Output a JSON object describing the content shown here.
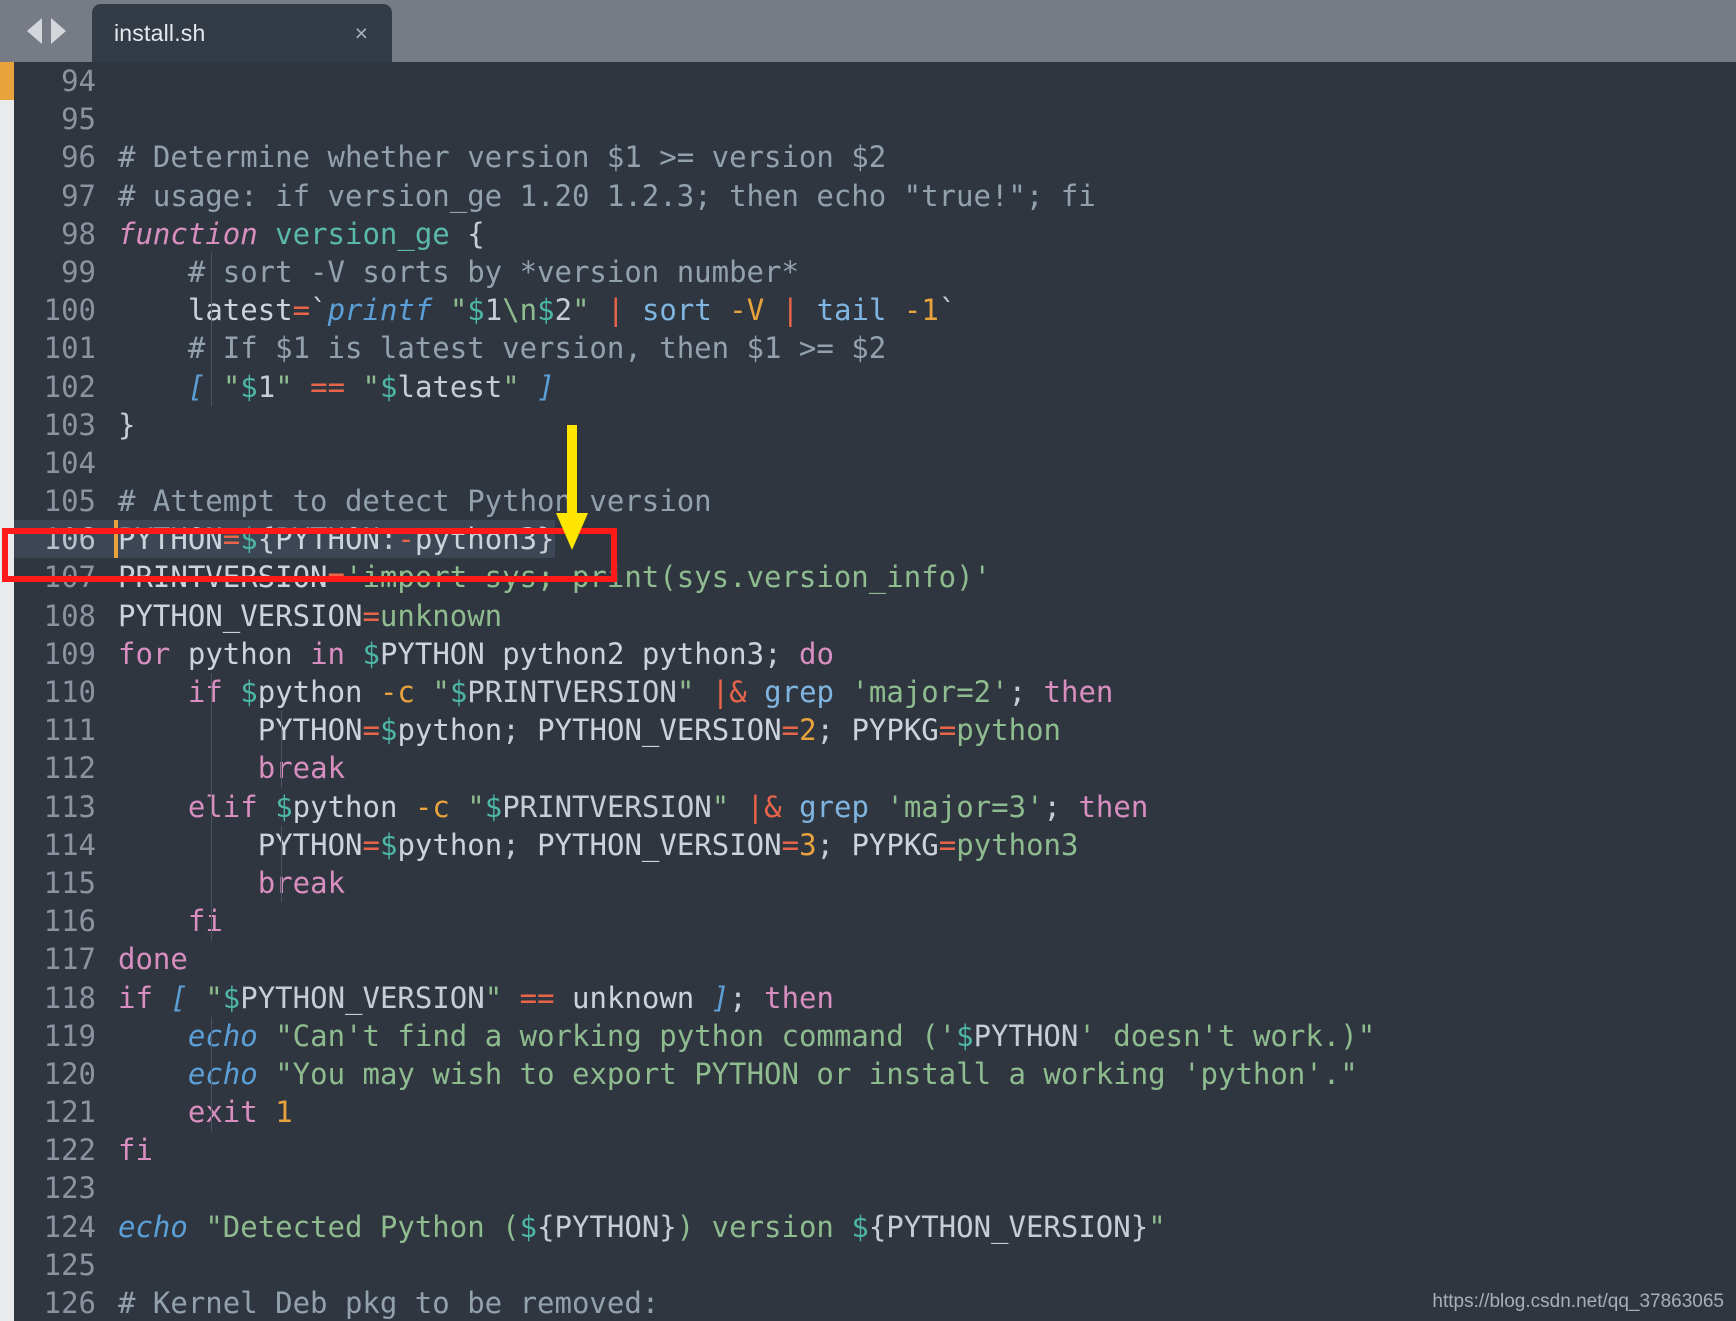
{
  "window": {
    "tab_title": "install.sh",
    "close_label": "×",
    "nav_back_icon": "arrow-left-icon",
    "nav_forward_icon": "arrow-right-icon"
  },
  "theme": {
    "tabbar_bg": "#767b85",
    "tab_bg": "#333b47",
    "editor_bg": "#2f3640",
    "gutter_text": "#8b939f",
    "current_line_bg": "#3c4654",
    "cursor_marker": "#e8a33d",
    "annotation_red": "#ff1a1a",
    "annotation_yellow": "#ffe600",
    "comment": "#93a1ad",
    "keyword": "#d88fc0",
    "string": "#8fbc8f",
    "operator": "#e8654a",
    "variable": "#4db6a4",
    "number": "#e8a33d",
    "builtin": "#5b9fd6"
  },
  "annotations": {
    "highlight_line": 106,
    "arrow_icon": "down-arrow-icon",
    "arrow_target_line": 106,
    "red_box_label": "highlight-box"
  },
  "watermark": "https://blog.csdn.net/qq_37863065",
  "editor": {
    "first_line": 94,
    "last_line": 126,
    "current_line": 106,
    "lines": [
      {
        "n": "94",
        "text": ""
      },
      {
        "n": "95",
        "text": ""
      },
      {
        "n": "96",
        "text": "# Determine whether version $1 >= version $2"
      },
      {
        "n": "97",
        "text": "# usage: if version_ge 1.20 1.2.3; then echo \"true!\"; fi"
      },
      {
        "n": "98",
        "text": "function version_ge {"
      },
      {
        "n": "99",
        "text": "    # sort -V sorts by *version number*"
      },
      {
        "n": "100",
        "text": "    latest=`printf \"$1\\n$2\" | sort -V | tail -1`"
      },
      {
        "n": "101",
        "text": "    # If $1 is latest version, then $1 >= $2"
      },
      {
        "n": "102",
        "text": "    [ \"$1\" == \"$latest\" ]"
      },
      {
        "n": "103",
        "text": "}"
      },
      {
        "n": "104",
        "text": ""
      },
      {
        "n": "105",
        "text": "# Attempt to detect Python version"
      },
      {
        "n": "106",
        "text": "PYTHON=${PYTHON:-python3}"
      },
      {
        "n": "107",
        "text": "PRINTVERSION='import sys; print(sys.version_info)'"
      },
      {
        "n": "108",
        "text": "PYTHON_VERSION=unknown"
      },
      {
        "n": "109",
        "text": "for python in $PYTHON python2 python3; do"
      },
      {
        "n": "110",
        "text": "    if $python -c \"$PRINTVERSION\" |& grep 'major=2'; then"
      },
      {
        "n": "111",
        "text": "        PYTHON=$python; PYTHON_VERSION=2; PYPKG=python"
      },
      {
        "n": "112",
        "text": "        break"
      },
      {
        "n": "113",
        "text": "    elif $python -c \"$PRINTVERSION\" |& grep 'major=3'; then"
      },
      {
        "n": "114",
        "text": "        PYTHON=$python; PYTHON_VERSION=3; PYPKG=python3"
      },
      {
        "n": "115",
        "text": "        break"
      },
      {
        "n": "116",
        "text": "    fi"
      },
      {
        "n": "117",
        "text": "done"
      },
      {
        "n": "118",
        "text": "if [ \"$PYTHON_VERSION\" == unknown ]; then"
      },
      {
        "n": "119",
        "text": "    echo \"Can't find a working python command ('$PYTHON' doesn't work.)\""
      },
      {
        "n": "120",
        "text": "    echo \"You may wish to export PYTHON or install a working 'python'.\""
      },
      {
        "n": "121",
        "text": "    exit 1"
      },
      {
        "n": "122",
        "text": "fi"
      },
      {
        "n": "123",
        "text": ""
      },
      {
        "n": "124",
        "text": "echo \"Detected Python (${PYTHON}) version ${PYTHON_VERSION}\""
      },
      {
        "n": "125",
        "text": ""
      },
      {
        "n": "126",
        "text": "# Kernel Deb pkg to be removed:"
      }
    ]
  }
}
